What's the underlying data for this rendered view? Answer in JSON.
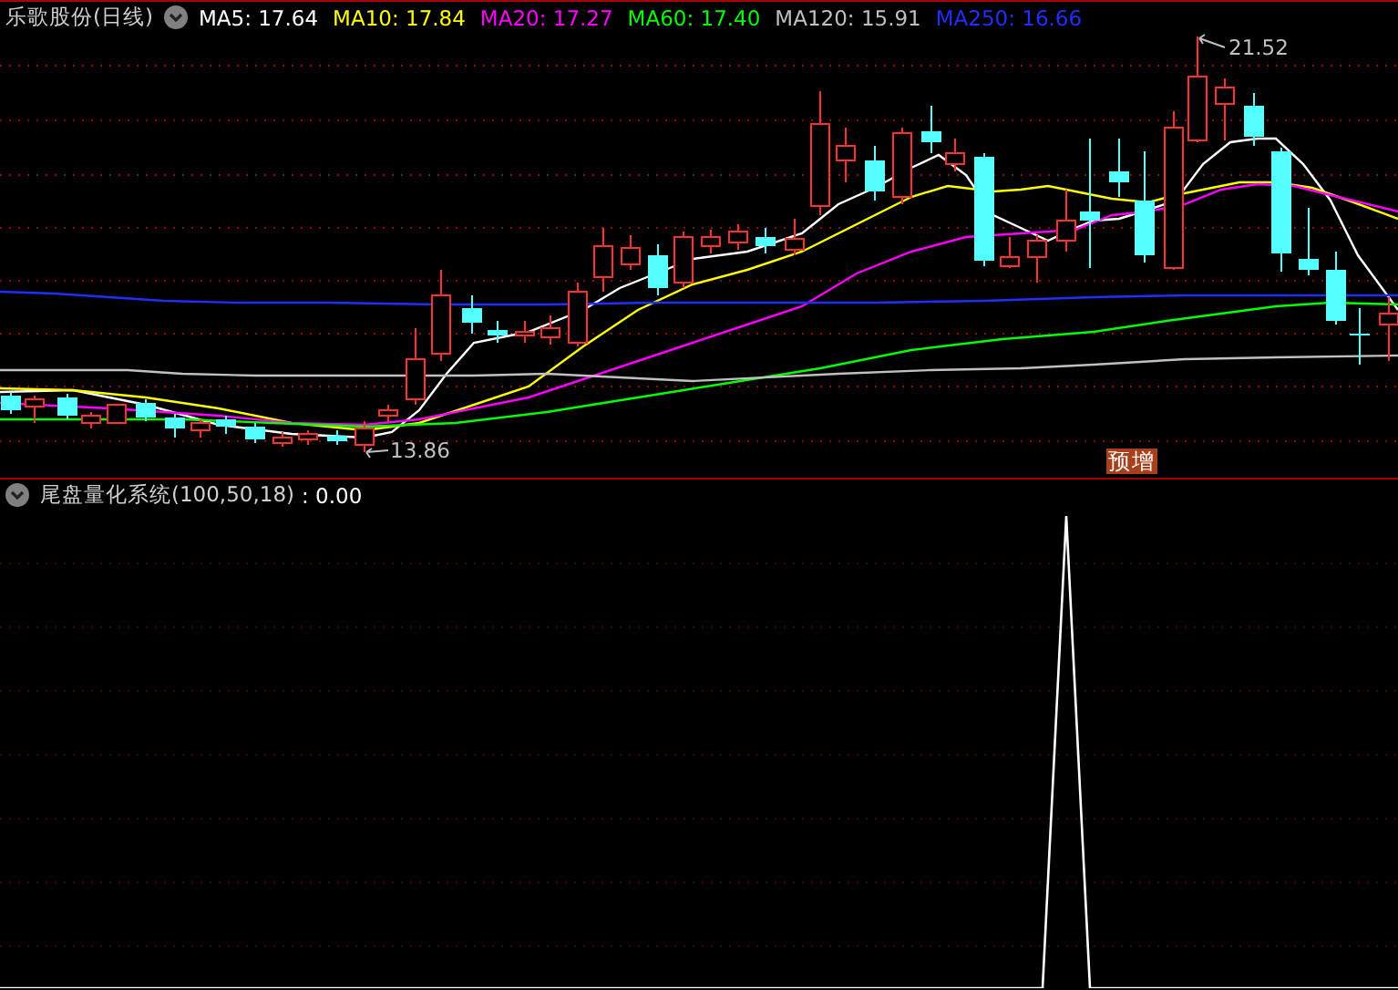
{
  "chart_header": {
    "title": "乐歌股份(日线)",
    "indicators": [
      {
        "label": "MA5: 17.64",
        "color": "#ffffff"
      },
      {
        "label": "MA10: 17.84",
        "color": "#ffff00"
      },
      {
        "label": "MA20: 17.27",
        "color": "#ff00ff"
      },
      {
        "label": "MA60: 17.40",
        "color": "#00ff00"
      },
      {
        "label": "MA120: 15.91",
        "color": "#c0c0c0"
      },
      {
        "label": "MA250: 16.66",
        "color": "#1f2fff"
      }
    ]
  },
  "price_labels": {
    "high": "21.52",
    "low": "13.86"
  },
  "badge": "预增",
  "indicator_panel": {
    "title": "尾盘量化系统(100,50,18)",
    "value": ": 0.00"
  }
}
